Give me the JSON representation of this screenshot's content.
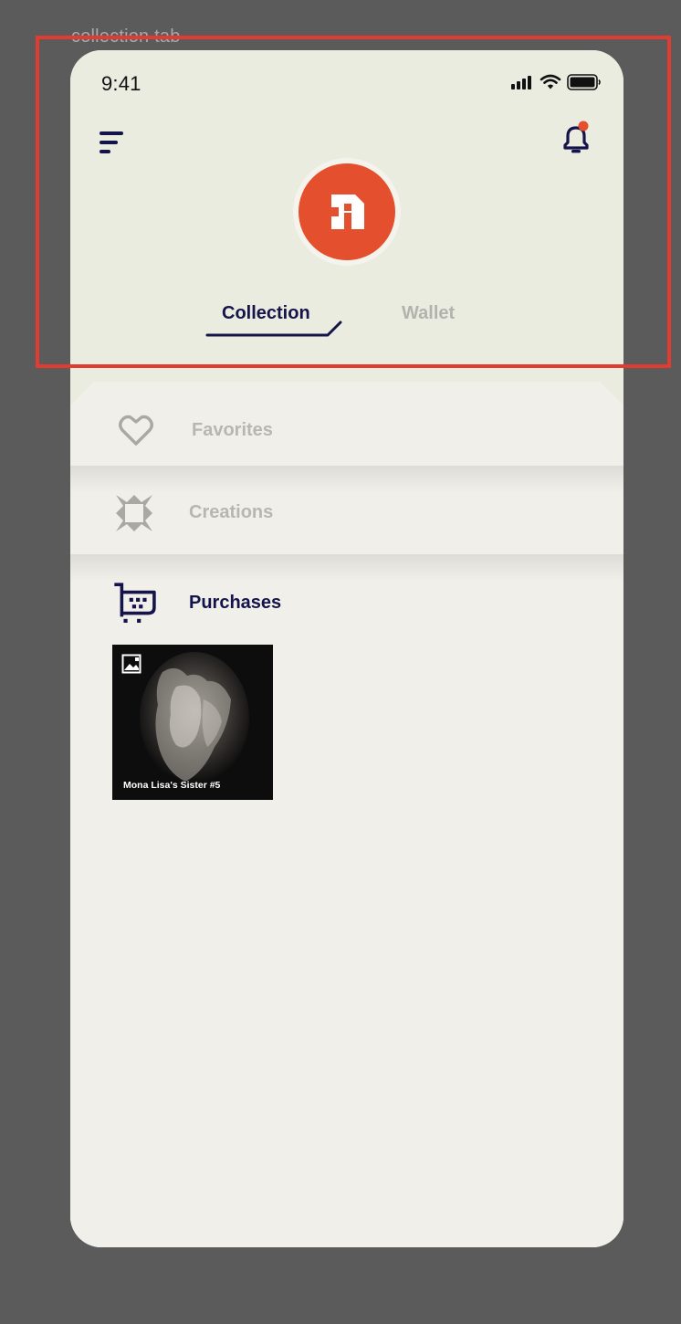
{
  "frame_label": "collection tab",
  "status_bar": {
    "time": "9:41"
  },
  "header": {
    "menu_icon": "filter-lines-icon",
    "notification_icon": "bell-icon",
    "logo_icon": "brand-logo"
  },
  "tabs": [
    {
      "label": "Collection",
      "active": true
    },
    {
      "label": "Wallet",
      "active": false
    }
  ],
  "sections": [
    {
      "label": "Favorites",
      "icon": "heart-icon",
      "active": false
    },
    {
      "label": "Creations",
      "icon": "starburst-icon",
      "active": false
    },
    {
      "label": "Purchases",
      "icon": "cart-icon",
      "active": true
    }
  ],
  "purchases": [
    {
      "title": "Mona Lisa's Sister #5",
      "badge_icon": "image-icon"
    }
  ],
  "colors": {
    "accent": "#e4502e",
    "navy": "#14134a",
    "header_bg": "#ebece0",
    "body_bg": "#f0efea",
    "highlight": "#e23b2f"
  }
}
